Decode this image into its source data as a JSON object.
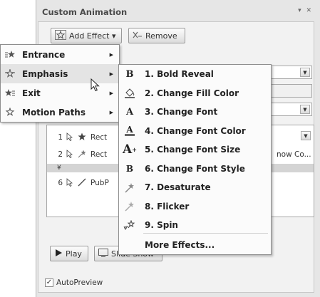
{
  "pane": {
    "title": "Custom Animation",
    "controls": "▾ ✕",
    "add_effect_label": "Add Effect ▾",
    "remove_label": "Remove",
    "behind_text": "now Co...",
    "play_label": "Play",
    "slideshow_label": "Slide Show",
    "autopreview_label": "AutoPreview",
    "autopreview_checked": true
  },
  "list": {
    "rows": [
      {
        "num": "1",
        "name": "Rect",
        "selected": false
      },
      {
        "num": "2",
        "name": "Rect",
        "selected": false
      },
      {
        "num": "",
        "name": "",
        "selected": true
      },
      {
        "num": "6",
        "name": "PubP",
        "selected": false
      }
    ]
  },
  "menu": {
    "items": [
      {
        "label": "Entrance",
        "icon": "green-star-icon",
        "arrow": "▶"
      },
      {
        "label": "Emphasis",
        "icon": "yellow-star-icon",
        "arrow": "▶"
      },
      {
        "label": "Exit",
        "icon": "red-star-icon",
        "arrow": "▶"
      },
      {
        "label": "Motion Paths",
        "icon": "outline-star-icon",
        "arrow": "▶"
      }
    ],
    "highlighted_index": 1
  },
  "submenu": {
    "items": [
      {
        "label": "1. Bold Reveal",
        "icon": "bold-b-icon",
        "glyph": "B"
      },
      {
        "label": "2. Change Fill Color",
        "icon": "paint-bucket-icon",
        "glyph": ""
      },
      {
        "label": "3. Change Font",
        "icon": "font-a-icon",
        "glyph": "A"
      },
      {
        "label": "4. Change Font Color",
        "icon": "font-color-a-icon",
        "glyph": "A"
      },
      {
        "label": "5. Change Font Size",
        "icon": "font-size-a-icon",
        "glyph": "A"
      },
      {
        "label": "6. Change Font Style",
        "icon": "font-style-b-icon",
        "glyph": "B"
      },
      {
        "label": "7. Desaturate",
        "icon": "desaturate-star-icon",
        "glyph": ""
      },
      {
        "label": "8. Flicker",
        "icon": "flicker-star-icon",
        "glyph": ""
      },
      {
        "label": "9. Spin",
        "icon": "spin-icon",
        "glyph": ""
      },
      {
        "label": "More Effects...",
        "icon": "",
        "glyph": ""
      }
    ]
  },
  "colors": {
    "pane_bg": "#e6e6e6",
    "menu_bg": "#fbfbfb",
    "highlight": "#e4e4e4"
  }
}
